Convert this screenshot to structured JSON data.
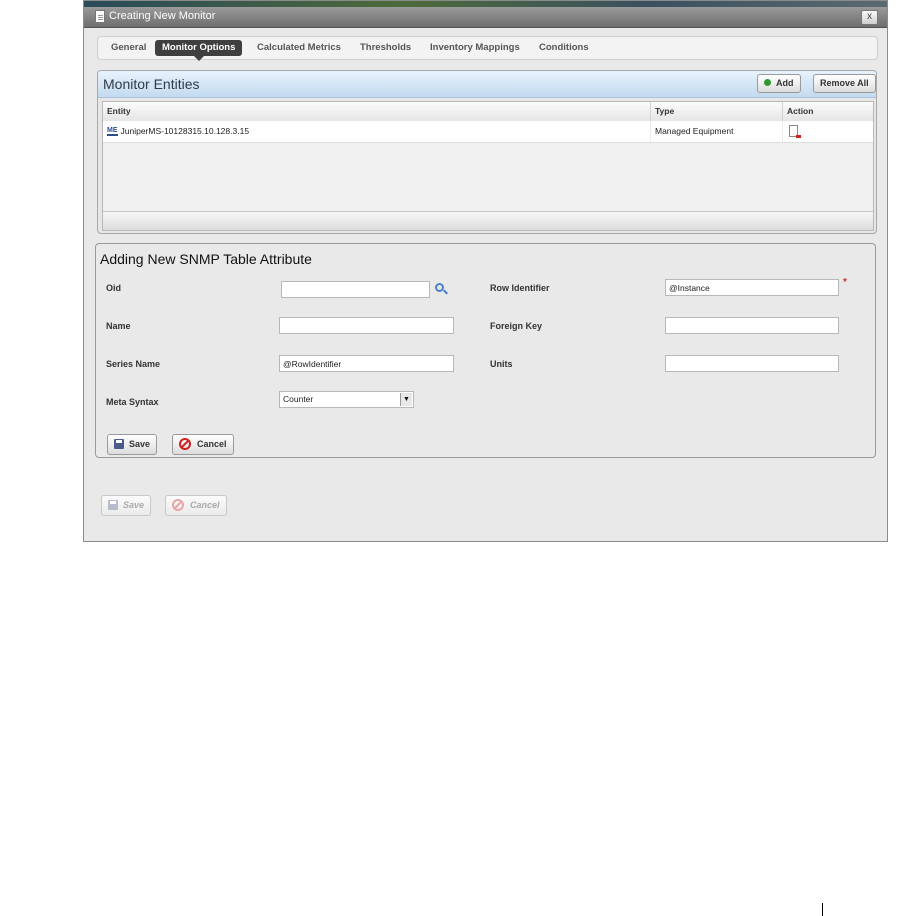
{
  "window": {
    "title": "Creating New Monitor",
    "close_label": "x"
  },
  "tabs": [
    {
      "label": "General",
      "active": false
    },
    {
      "label": "Monitor Options",
      "active": true
    },
    {
      "label": "Calculated Metrics",
      "active": false
    },
    {
      "label": "Thresholds",
      "active": false
    },
    {
      "label": "Inventory Mappings",
      "active": false
    },
    {
      "label": "Conditions",
      "active": false
    }
  ],
  "entities_panel": {
    "title": "Monitor Entities",
    "add_label": "Add",
    "remove_all_label": "Remove All",
    "columns": [
      "Entity",
      "Type",
      "Action"
    ],
    "rows": [
      {
        "entity_icon": "ME",
        "entity": "JuniperMS-10128315.10.128.3.15",
        "type": "Managed Equipment",
        "action_icon": "document-remove-icon"
      }
    ]
  },
  "form": {
    "title": "Adding New SNMP Table Attribute",
    "oid_label": "Oid",
    "oid_value": "",
    "row_identifier_label": "Row Identifier",
    "row_identifier_value": "@Instance",
    "name_label": "Name",
    "name_value": "",
    "foreign_key_label": "Foreign Key",
    "foreign_key_value": "",
    "series_name_label": "Series Name",
    "series_name_value": "@RowIdentifier",
    "units_label": "Units",
    "units_value": "",
    "meta_syntax_label": "Meta Syntax",
    "meta_syntax_value": "Counter",
    "save_label": "Save",
    "cancel_label": "Cancel"
  },
  "footer": {
    "save_label": "Save",
    "cancel_label": "Cancel"
  },
  "colors": {
    "active_tab": "#3f3f3f",
    "panel_header": "#c3daf0",
    "required": "#c43030",
    "cancel": "#d02020"
  }
}
